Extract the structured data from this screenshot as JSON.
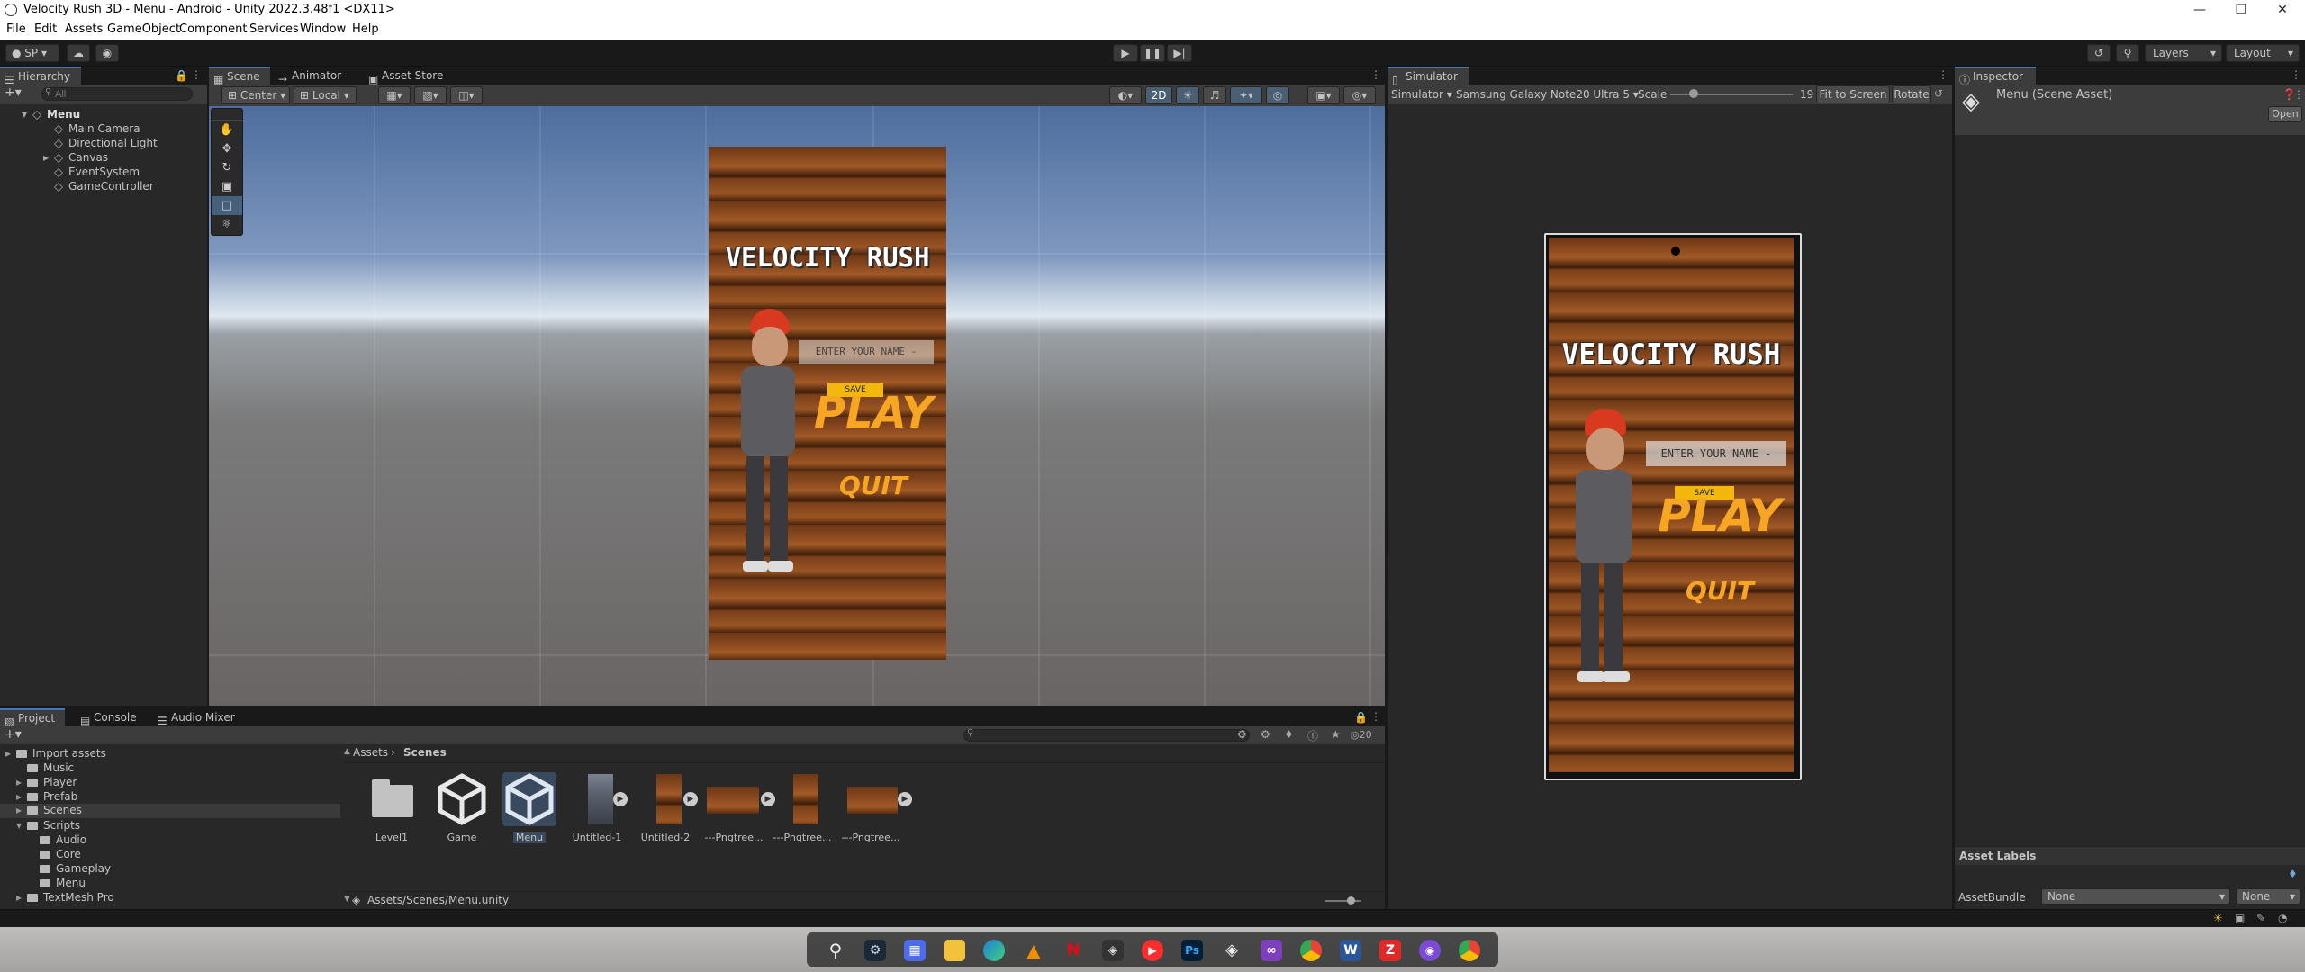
{
  "window": {
    "title": "Velocity Rush 3D - Menu - Android - Unity 2022.3.48f1 <DX11>"
  },
  "menubar": [
    "File",
    "Edit",
    "Assets",
    "GameObject",
    "Component",
    "Services",
    "Window",
    "Help"
  ],
  "toolbar": {
    "account": "SP",
    "layers": "Layers",
    "layout": "Layout"
  },
  "hierarchy": {
    "tab": "Hierarchy",
    "search_placeholder": "All",
    "scene": "Menu",
    "items": [
      "Main Camera",
      "Directional Light",
      "Canvas",
      "EventSystem",
      "GameController"
    ]
  },
  "scene": {
    "tabs": [
      "Scene",
      "Animator",
      "Asset Store"
    ],
    "pivot": "Center",
    "space": "Local",
    "mode_2d": "2D"
  },
  "game_ui": {
    "title": "VELOCITY RUSH",
    "name_placeholder": "ENTER YOUR NAME -",
    "save": "SAVE",
    "play": "PLAY",
    "quit": "QUIT"
  },
  "simulator": {
    "tab": "Simulator",
    "mode": "Simulator",
    "device": "Samsung Galaxy Note20 Ultra 5",
    "scale_label": "Scale",
    "scale_value": "19",
    "scale_fraction": 0.19,
    "fit": "Fit to Screen",
    "rotate": "Rotate"
  },
  "inspector": {
    "tab": "Inspector",
    "title": "Menu (Scene Asset)",
    "open": "Open",
    "asset_labels": "Asset Labels",
    "assetbundle_label": "AssetBundle",
    "assetbundle_value": "None",
    "variant_value": "None"
  },
  "project": {
    "tabs": [
      "Project",
      "Console",
      "Audio Mixer"
    ],
    "hidden_count": "20",
    "tree": [
      {
        "label": "Import assets",
        "indent": 1
      },
      {
        "label": "Music",
        "indent": 1
      },
      {
        "label": "Player",
        "indent": 1
      },
      {
        "label": "Prefab",
        "indent": 1
      },
      {
        "label": "Scenes",
        "indent": 1
      },
      {
        "label": "Scripts",
        "indent": 1
      },
      {
        "label": "Audio",
        "indent": 2
      },
      {
        "label": "Core",
        "indent": 2
      },
      {
        "label": "Gameplay",
        "indent": 2
      },
      {
        "label": "Menu",
        "indent": 2
      },
      {
        "label": "TextMesh Pro",
        "indent": 1
      }
    ],
    "breadcrumb": [
      "Assets",
      "Scenes"
    ],
    "assets": [
      "Level1",
      "Game",
      "Menu",
      "Untitled-1",
      "Untitled-2",
      "---Pngtree...",
      "---Pngtree...",
      "---Pngtree..."
    ],
    "path": "Assets/Scenes/Menu.unity"
  },
  "colors": {
    "accent": "#3a79bb",
    "orange": "#f6a623",
    "panel": "#282828",
    "wood": "#8e4b1f"
  }
}
